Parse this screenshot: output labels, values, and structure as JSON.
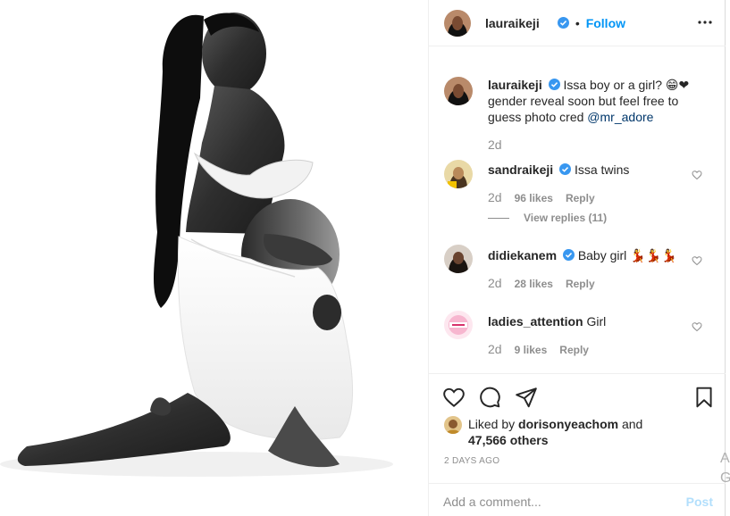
{
  "post": {
    "username": "lauraikeji",
    "follow_label": "Follow",
    "separator": "•"
  },
  "caption": {
    "username": "lauraikeji",
    "text_before": "Issa boy or a girl? ",
    "emojis": "😁❤",
    "text_after": " gender reveal soon but feel free to guess photo cred ",
    "mention": "@mr_adore",
    "time": "2d"
  },
  "comments": [
    {
      "username": "sandraikeji",
      "text": "Issa twins",
      "time": "2d",
      "likes": "96 likes",
      "reply_label": "Reply",
      "view_replies": "View replies (11)"
    },
    {
      "username": "didiekanem",
      "text": "Baby girl 💃💃💃",
      "time": "2d",
      "likes": "28 likes",
      "reply_label": "Reply"
    },
    {
      "username": "ladies_attention",
      "text": "Girl",
      "time": "2d",
      "likes": "9 likes",
      "reply_label": "Reply"
    }
  ],
  "likes": {
    "prefix": "Liked by ",
    "user": "dorisonyeachom",
    "middle": " and",
    "others": "47,566 others"
  },
  "date": "2 DAYS AGO",
  "add_comment": {
    "placeholder": "Add a comment...",
    "post_label": "Post"
  },
  "edge_chars": [
    "A",
    "G"
  ],
  "colors": {
    "link_blue": "#0095f6",
    "verified_blue": "#3897f0",
    "muted": "#8e8e8e",
    "post_disabled": "#b2dffc"
  },
  "icons": [
    "more-icon",
    "verified-icon",
    "heart-icon",
    "comment-icon",
    "share-icon",
    "bookmark-icon"
  ]
}
